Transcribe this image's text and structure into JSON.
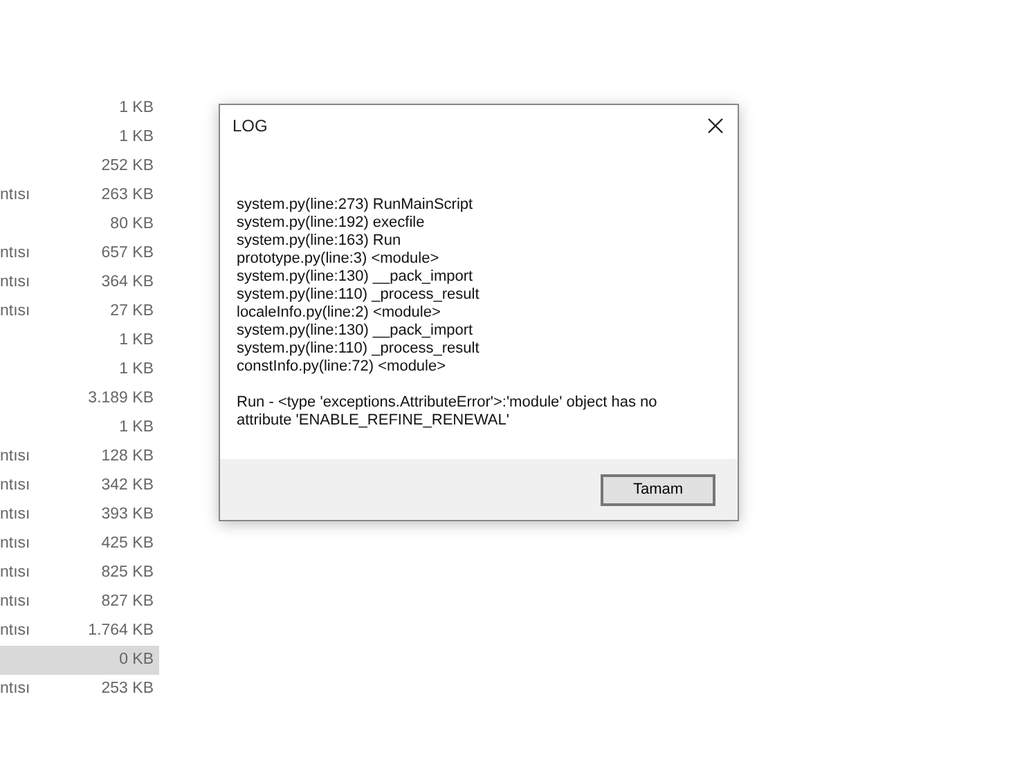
{
  "file_list": [
    {
      "size": "1 KB",
      "selected": false
    },
    {
      "size": "1 KB",
      "selected": false
    },
    {
      "size": "252 KB",
      "selected": false
    },
    {
      "type": "ntısı",
      "size": "263 KB",
      "selected": false
    },
    {
      "size": "80 KB",
      "selected": false
    },
    {
      "type": "ntısı",
      "size": "657 KB",
      "selected": false
    },
    {
      "type": "ntısı",
      "size": "364 KB",
      "selected": false
    },
    {
      "type": "ntısı",
      "size": "27 KB",
      "selected": false
    },
    {
      "size": "1 KB",
      "selected": false
    },
    {
      "size": "1 KB",
      "selected": false
    },
    {
      "size": "3.189 KB",
      "selected": false
    },
    {
      "size": "1 KB",
      "selected": false
    },
    {
      "type": "ntısı",
      "size": "128 KB",
      "selected": false
    },
    {
      "type": "ntısı",
      "size": "342 KB",
      "selected": false
    },
    {
      "type": "ntısı",
      "size": "393 KB",
      "selected": false
    },
    {
      "type": "ntısı",
      "size": "425 KB",
      "selected": false
    },
    {
      "type": "ntısı",
      "size": "825 KB",
      "selected": false
    },
    {
      "type": "ntısı",
      "size": "827 KB",
      "selected": false
    },
    {
      "type": "ntısı",
      "size": "1.764 KB",
      "selected": false
    },
    {
      "size": "0 KB",
      "selected": true
    },
    {
      "type": "ntısı",
      "size": "253 KB",
      "selected": false
    }
  ],
  "dialog": {
    "title": "LOG",
    "log_lines": [
      "system.py(line:273) RunMainScript",
      "system.py(line:192) execfile",
      "system.py(line:163) Run",
      "prototype.py(line:3) <module>",
      "system.py(line:130) __pack_import",
      "system.py(line:110) _process_result",
      "localeInfo.py(line:2) <module>",
      "system.py(line:130) __pack_import",
      "system.py(line:110) _process_result",
      "constInfo.py(line:72) <module>"
    ],
    "message": "Run - <type 'exceptions.AttributeError'>:'module' object has no attribute 'ENABLE_REFINE_RENEWAL'",
    "buttons": [
      "Tamam"
    ]
  }
}
